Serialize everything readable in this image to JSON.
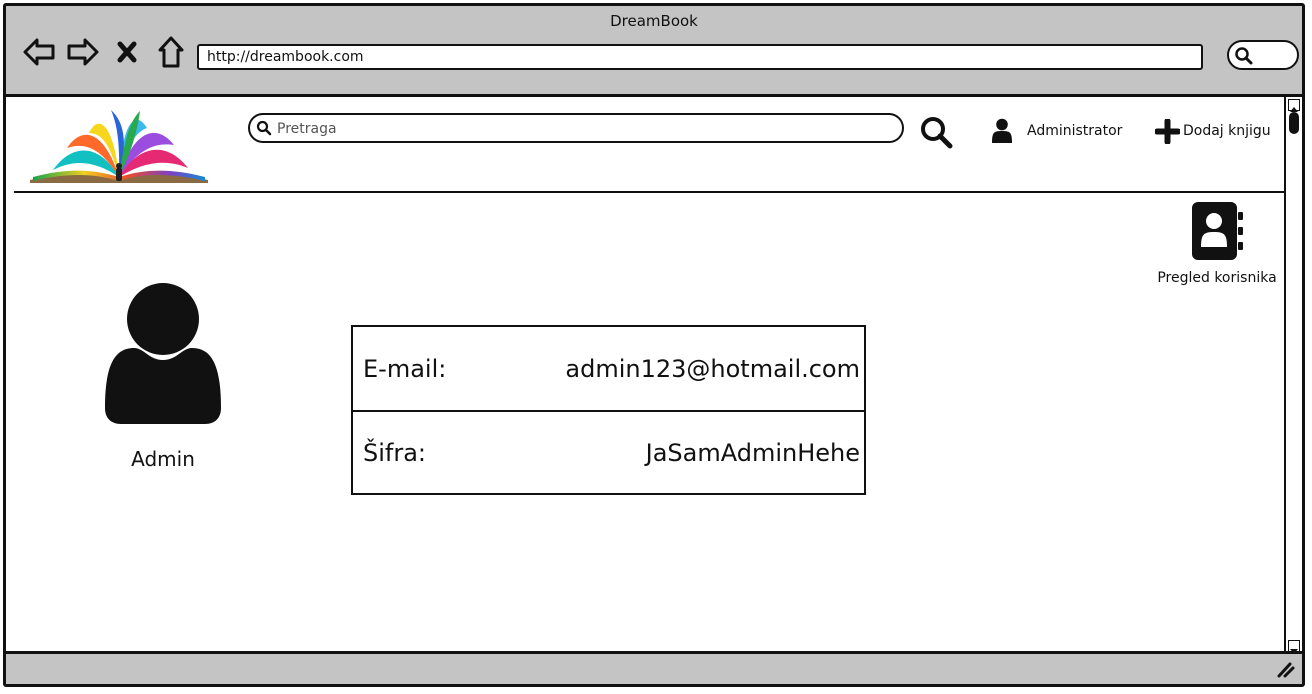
{
  "window": {
    "title": "DreamBook"
  },
  "browser": {
    "url": "http://dreambook.com",
    "nav": [
      "back-arrow-icon",
      "forward-arrow-icon",
      "close-icon",
      "home-icon"
    ],
    "search_icon": "search-icon"
  },
  "header": {
    "search_placeholder": "Pretraga",
    "search_button_icon": "search-icon",
    "user_label": "Administrator",
    "add_book_label": "Dodaj knjigu"
  },
  "sidebar": {
    "users_label": "Pregled korisnika",
    "users_icon": "address-book-icon"
  },
  "profile": {
    "name": "Admin",
    "avatar_icon": "person-avatar-icon"
  },
  "account": {
    "rows": [
      {
        "label": "E-mail:",
        "value": "admin123@hotmail.com"
      },
      {
        "label": "Šifra:",
        "value": "JaSamAdminHehe"
      }
    ]
  },
  "colors": {
    "chrome": "#c4c4c4",
    "ink": "#111111",
    "background": "#ffffff"
  }
}
